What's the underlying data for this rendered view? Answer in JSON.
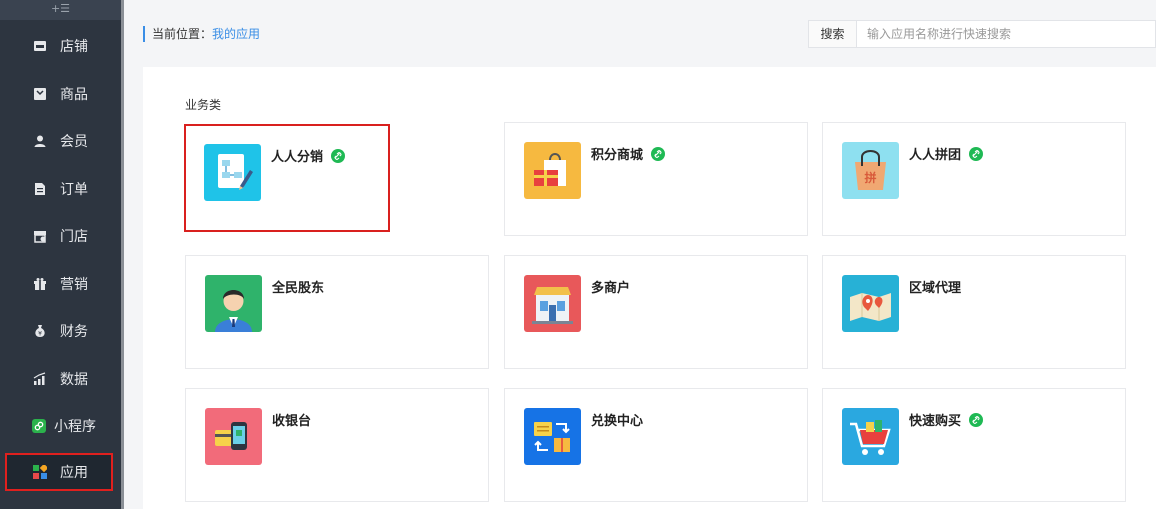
{
  "sidebar": {
    "toggle": "+☰",
    "items": [
      {
        "label": "店铺",
        "icon": "store-icon"
      },
      {
        "label": "商品",
        "icon": "goods-icon"
      },
      {
        "label": "会员",
        "icon": "member-icon"
      },
      {
        "label": "订单",
        "icon": "order-icon"
      },
      {
        "label": "门店",
        "icon": "shop-icon"
      },
      {
        "label": "营销",
        "icon": "gift-icon"
      },
      {
        "label": "财务",
        "icon": "money-bag-icon"
      },
      {
        "label": "数据",
        "icon": "chart-icon"
      },
      {
        "label": "小程序",
        "icon": "mini-program-icon"
      },
      {
        "label": "应用",
        "icon": "apps-icon",
        "active": true
      }
    ]
  },
  "header": {
    "crumb_prefix": "当前位置：",
    "crumb_current": "我的应用",
    "search_button": "搜索",
    "search_placeholder": "输入应用名称进行快速搜索"
  },
  "section": {
    "title": "业务类"
  },
  "apps": [
    {
      "name": "人人分销",
      "icon": "distribution-icon",
      "linked": true,
      "color": "#1fc3e8"
    },
    {
      "name": "积分商城",
      "icon": "points-mall-icon",
      "linked": true,
      "color": "#f6b940"
    },
    {
      "name": "人人拼团",
      "icon": "group-buy-icon",
      "linked": true,
      "color": "#8ee0f0"
    },
    {
      "name": "全民股东",
      "icon": "shareholder-icon",
      "linked": false,
      "color": "#2fb36b"
    },
    {
      "name": "多商户",
      "icon": "multi-merchant-icon",
      "linked": false,
      "color": "#e8585a"
    },
    {
      "name": "区域代理",
      "icon": "regional-agent-icon",
      "linked": false,
      "color": "#27b1d6"
    },
    {
      "name": "收银台",
      "icon": "cashier-icon",
      "linked": false,
      "color": "#f26b7a"
    },
    {
      "name": "兑换中心",
      "icon": "exchange-center-icon",
      "linked": false,
      "color": "#1673e6"
    },
    {
      "name": "快速购买",
      "icon": "quick-buy-icon",
      "linked": true,
      "color": "#2aa8e0"
    }
  ]
}
